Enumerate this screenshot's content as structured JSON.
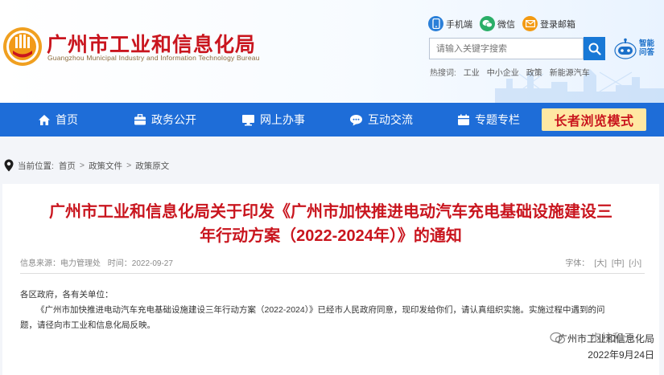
{
  "header": {
    "site_title": "广州市工业和信息化局",
    "site_subtitle": "Guangzhou Municipal Industry and Information Technology Bureau",
    "top_links": [
      {
        "label": "手机端",
        "icon": "mobile-icon",
        "color": "#2a7fd8"
      },
      {
        "label": "微信",
        "icon": "wechat-icon",
        "color": "#2aae67"
      },
      {
        "label": "登录邮箱",
        "icon": "mail-icon",
        "color": "#f39a12"
      }
    ],
    "search": {
      "placeholder": "请输入关键字搜索"
    },
    "robot_label": "智能问答",
    "hot_label": "热搜词:",
    "hot_words": [
      "工业",
      "中小企业",
      "政策",
      "新能源汽车"
    ]
  },
  "nav": {
    "items": [
      {
        "label": "首页",
        "icon": "home-icon"
      },
      {
        "label": "政务公开",
        "icon": "briefcase-icon"
      },
      {
        "label": "网上办事",
        "icon": "monitor-icon"
      },
      {
        "label": "互动交流",
        "icon": "chat-icon"
      },
      {
        "label": "专题专栏",
        "icon": "calendar-icon"
      }
    ],
    "elder_mode": "长者浏览模式"
  },
  "breadcrumb": {
    "label": "当前位置:",
    "items": [
      "首页",
      "政策文件",
      "政策原文"
    ],
    "separator": ">"
  },
  "article": {
    "title_line1": "广州市工业和信息化局关于印发《广州市加快推进电动汽车充电基础设施建设三",
    "title_line2": "年行动方案（2022-2024年）》的通知",
    "source": "信息来源：电力管理处",
    "date": "时间：2022-09-27",
    "font_label": "字体：",
    "font_sizes": [
      "[大]",
      "[中]",
      "[小]"
    ],
    "greeting": "各区政府，各有关单位：",
    "body_line1": "《广州市加快推进电动汽车充电基础设施建设三年行动方案（2022-2024）》已经市人民政府同意，现印发给你们，请认真组织实施。实施过程中遇到的问",
    "body_line2": "题，请径向市工业和信息化局反映。",
    "signature_org": "广州市工业和信息化局",
    "signature_date": "2022年9月24日",
    "watermark": "步校和元"
  },
  "colors": {
    "brand_red": "#c9151e",
    "nav_blue": "#1e6dd8",
    "elder_bg": "#ffe8a3",
    "search_blue": "#1878d6"
  }
}
